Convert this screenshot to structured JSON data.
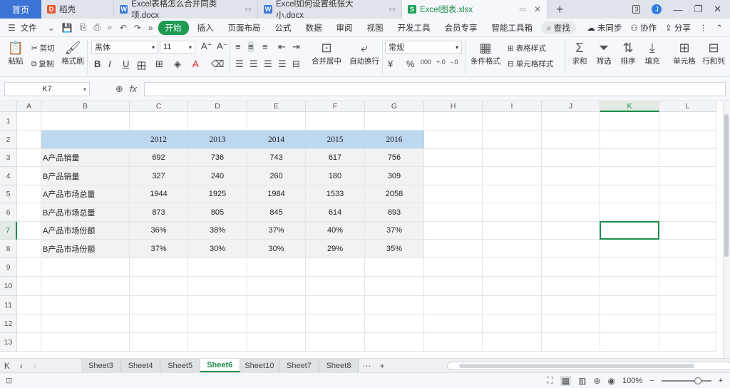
{
  "titlebar": {
    "home_label": "首页",
    "tabs": [
      {
        "label": "稻壳",
        "icon": "daoke-icon"
      },
      {
        "label": "Excel表格怎么合并同类项.docx",
        "icon": "writer-icon"
      },
      {
        "label": "Excel如何设置纸张大小.docx",
        "icon": "writer-icon"
      },
      {
        "label": "Excel图表.xlsx",
        "icon": "spreadsheet-icon"
      }
    ],
    "add_tab": "+",
    "window_badge": "3"
  },
  "menubar": {
    "file": "文件",
    "items": [
      "开始",
      "插入",
      "页面布局",
      "公式",
      "数据",
      "审阅",
      "视图",
      "开发工具",
      "会员专享",
      "智能工具箱"
    ],
    "search": "查找",
    "sync": "未同步",
    "collab": "协作",
    "share": "分享"
  },
  "ribbon": {
    "paste": "粘贴",
    "cut": "剪切",
    "copy": "复制",
    "format_painter": "格式刷",
    "font_name": "黑体",
    "font_size": "11",
    "merge_center": "合并居中",
    "wrap_text": "自动换行",
    "number_format": "常规",
    "conditional_format": "条件格式",
    "table_style": "表格样式",
    "cell_style": "单元格样式",
    "sum": "求和",
    "filter": "筛选",
    "sort": "排序",
    "fill": "填充",
    "cells": "单元格",
    "rows_cols": "行和列"
  },
  "formulabar": {
    "name_box": "K7",
    "fx": "fx",
    "formula": ""
  },
  "columns": [
    "A",
    "B",
    "C",
    "D",
    "E",
    "F",
    "G",
    "H",
    "I",
    "J",
    "K",
    "L"
  ],
  "rows": [
    "1",
    "2",
    "3",
    "4",
    "5",
    "6",
    "7",
    "8",
    "9",
    "10",
    "11",
    "12",
    "13"
  ],
  "table": {
    "years": [
      "2012",
      "2013",
      "2014",
      "2015",
      "2016"
    ],
    "rows": [
      {
        "label": "A产品销量",
        "values": [
          "692",
          "736",
          "743",
          "617",
          "756"
        ]
      },
      {
        "label": "B产品销量",
        "values": [
          "327",
          "240",
          "260",
          "180",
          "309"
        ]
      },
      {
        "label": "A产品市场总量",
        "values": [
          "1944",
          "1925",
          "1984",
          "1533",
          "2058"
        ]
      },
      {
        "label": "B产品市场总量",
        "values": [
          "873",
          "805",
          "845",
          "614",
          "893"
        ]
      },
      {
        "label": "A产品市场份额",
        "values": [
          "36%",
          "38%",
          "37%",
          "40%",
          "37%"
        ]
      },
      {
        "label": "B产品市场份额",
        "values": [
          "37%",
          "30%",
          "30%",
          "29%",
          "35%"
        ]
      }
    ]
  },
  "sheets": [
    "Sheet3",
    "Sheet4",
    "Sheet5",
    "Sheet6",
    "Sheet10",
    "Sheet7",
    "Sheet8"
  ],
  "active_sheet": "Sheet6",
  "status": {
    "zoom": "100%",
    "zoom_minus": "−",
    "zoom_plus": "+"
  },
  "colors": {
    "accent_green": "#1e8c4a",
    "header_band": "#bdd7ee",
    "data_band": "#f2f2f2",
    "home_blue": "#3c74d6"
  }
}
